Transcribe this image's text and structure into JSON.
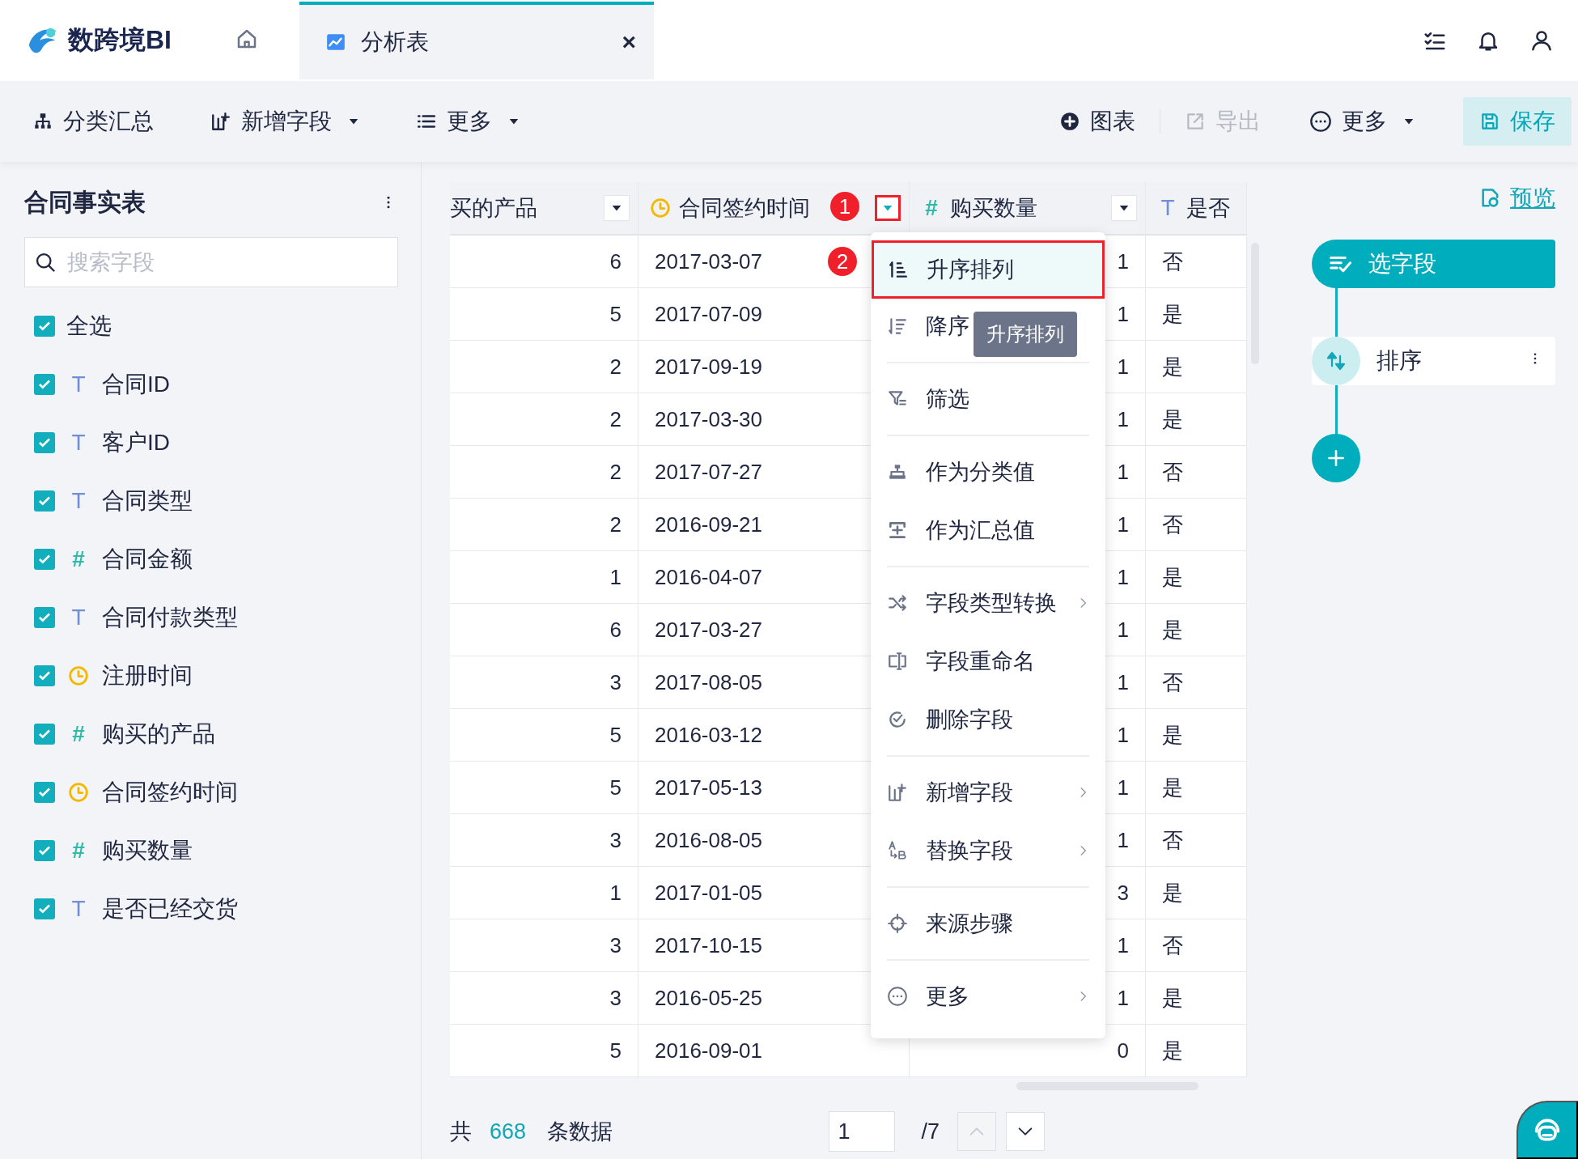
{
  "app": {
    "logo_text": "数跨境BI"
  },
  "tabs": [
    {
      "label": "分析表",
      "selected": true,
      "close": "×"
    }
  ],
  "toolbar": {
    "left": [
      {
        "label": "分类汇总",
        "dropdown": false
      },
      {
        "label": "新增字段",
        "dropdown": true
      },
      {
        "label": "更多",
        "dropdown": true
      }
    ],
    "right": [
      {
        "label": "图表",
        "dropdown": false,
        "disabled": false,
        "kind": "plain"
      },
      {
        "label": "导出",
        "dropdown": false,
        "disabled": true,
        "kind": "plain"
      },
      {
        "label": "更多",
        "dropdown": true,
        "disabled": false,
        "kind": "plain"
      },
      {
        "label": "保存",
        "dropdown": false,
        "disabled": false,
        "kind": "primary"
      }
    ]
  },
  "field_panel": {
    "title": "合同事实表",
    "search": {
      "placeholder": "搜索字段"
    },
    "select_all": {
      "label": "全选",
      "checked": true
    },
    "fields": [
      {
        "label": "合同ID",
        "kind": "text",
        "glyph": "T",
        "checked": true
      },
      {
        "label": "客户ID",
        "kind": "text",
        "glyph": "T",
        "checked": true
      },
      {
        "label": "合同类型",
        "kind": "text",
        "glyph": "T",
        "checked": true
      },
      {
        "label": "合同金额",
        "kind": "number",
        "glyph": "#",
        "checked": true
      },
      {
        "label": "合同付款类型",
        "kind": "text",
        "glyph": "T",
        "checked": true
      },
      {
        "label": "注册时间",
        "kind": "date",
        "checked": true
      },
      {
        "label": "购买的产品",
        "kind": "number",
        "glyph": "#",
        "checked": true
      },
      {
        "label": "合同签约时间",
        "kind": "date",
        "checked": true
      },
      {
        "label": "购买数量",
        "kind": "number",
        "glyph": "#",
        "checked": true
      },
      {
        "label": "是否已经交货",
        "kind": "text",
        "glyph": "T",
        "checked": true
      }
    ]
  },
  "table": {
    "columns": [
      {
        "label": "买的产品",
        "kind": "number",
        "highlighted": false,
        "dropdown": true
      },
      {
        "label": "合同签约时间",
        "kind": "date",
        "highlighted": true,
        "dropdown": true
      },
      {
        "label": "购买数量",
        "kind": "number",
        "glyph": "#",
        "highlighted": false,
        "dropdown": true
      },
      {
        "label": "是否",
        "kind": "text",
        "glyph": "T",
        "highlighted": false,
        "dropdown": false
      }
    ],
    "rows": [
      [
        "6",
        "2017-03-07",
        "1",
        "否"
      ],
      [
        "5",
        "2017-07-09",
        "1",
        "是"
      ],
      [
        "2",
        "2017-09-19",
        "1",
        "是"
      ],
      [
        "2",
        "2017-03-30",
        "1",
        "是"
      ],
      [
        "2",
        "2017-07-27",
        "1",
        "否"
      ],
      [
        "2",
        "2016-09-21",
        "1",
        "否"
      ],
      [
        "1",
        "2016-04-07",
        "1",
        "是"
      ],
      [
        "6",
        "2017-03-27",
        "1",
        "是"
      ],
      [
        "3",
        "2017-08-05",
        "1",
        "否"
      ],
      [
        "5",
        "2016-03-12",
        "1",
        "是"
      ],
      [
        "5",
        "2017-05-13",
        "1",
        "是"
      ],
      [
        "3",
        "2016-08-05",
        "1",
        "否"
      ],
      [
        "1",
        "2017-01-05",
        "3",
        "是"
      ],
      [
        "3",
        "2017-10-15",
        "1",
        "否"
      ],
      [
        "3",
        "2016-05-25",
        "1",
        "是"
      ],
      [
        "5",
        "2016-09-01",
        "0",
        "是"
      ]
    ]
  },
  "column_menu": {
    "groups": [
      [
        {
          "label": "升序排列",
          "highlighted": true,
          "submenu": false
        },
        {
          "label": "降序",
          "highlighted": false,
          "submenu": false
        }
      ],
      [
        {
          "label": "筛选",
          "highlighted": false,
          "submenu": false
        }
      ],
      [
        {
          "label": "作为分类值",
          "highlighted": false,
          "submenu": false
        },
        {
          "label": "作为汇总值",
          "highlighted": false,
          "submenu": false
        }
      ],
      [
        {
          "label": "字段类型转换",
          "highlighted": false,
          "submenu": true
        },
        {
          "label": "字段重命名",
          "highlighted": false,
          "submenu": false
        },
        {
          "label": "删除字段",
          "highlighted": false,
          "submenu": false
        }
      ],
      [
        {
          "label": "新增字段",
          "highlighted": false,
          "submenu": true
        },
        {
          "label": "替换字段",
          "highlighted": false,
          "submenu": true
        }
      ],
      [
        {
          "label": "来源步骤",
          "highlighted": false,
          "submenu": false
        }
      ],
      [
        {
          "label": "更多",
          "highlighted": false,
          "submenu": true
        }
      ]
    ],
    "tooltip": "升序排列"
  },
  "annotations": [
    {
      "label": "1"
    },
    {
      "label": "2"
    }
  ],
  "footer": {
    "prefix": "共",
    "count": "668",
    "suffix": "条数据",
    "page": "1",
    "total": "/7",
    "prev_disabled": true,
    "next_disabled": false
  },
  "steps": {
    "preview": "预览",
    "items": [
      {
        "label": "选字段",
        "selected": true
      },
      {
        "label": "排序",
        "selected": false
      }
    ]
  }
}
